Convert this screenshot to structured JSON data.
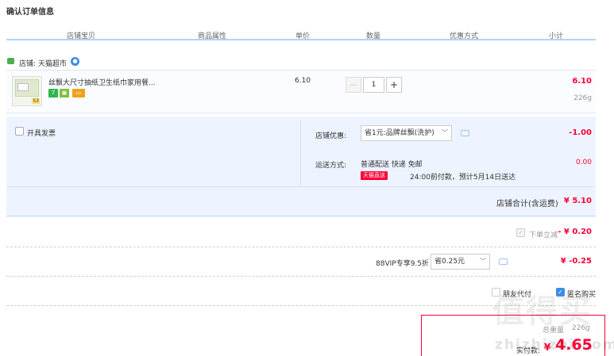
{
  "title": "确认订单信息",
  "columns": [
    "店铺宝贝",
    "商品属性",
    "单价",
    "数量",
    "优惠方式",
    "小计"
  ],
  "shop": {
    "label": "店铺: 天猫超市"
  },
  "item": {
    "name": "丝飘大尺寸抽纸卫生纸巾家用餐...",
    "thumb_tag": "53",
    "unit_price": "6.10",
    "quantity": "1",
    "subtotal": "6.10",
    "weight": "226g"
  },
  "invoice": {
    "label": "开具发票"
  },
  "shop_discount": {
    "label": "店铺优惠:",
    "selected": "省1元:品牌丝飘(洗护)",
    "amount": "-1.00"
  },
  "delivery": {
    "label": "运送方式:",
    "method": "普通配送 快递 免邮",
    "tag": "天猫直送",
    "note": "24:00前付款，预计5月14日送达",
    "amount": "0.00"
  },
  "shop_total": {
    "label": "店铺合计(含运费)",
    "amount": "¥ 5.10"
  },
  "instant_discount": {
    "label": "下单立减",
    "amount": "- ¥ 0.20"
  },
  "vip": {
    "label": "88VIP专享9.5折",
    "selected": "省0.25元",
    "amount": "¥ -0.25"
  },
  "options": {
    "friend_pay": "朋友代付",
    "anonymous": "匿名购买"
  },
  "payment": {
    "weight_label": "总重量",
    "weight": "226g",
    "pay_label": "实付款:",
    "pay_currency": "¥",
    "pay_amount": "4.65"
  },
  "watermark": {
    "text": "值得买",
    "url": "zhizhizhi.com"
  },
  "colors": {
    "accent": "#ff0036",
    "line": "#b2d1ff",
    "panel": "#eef4ff"
  }
}
